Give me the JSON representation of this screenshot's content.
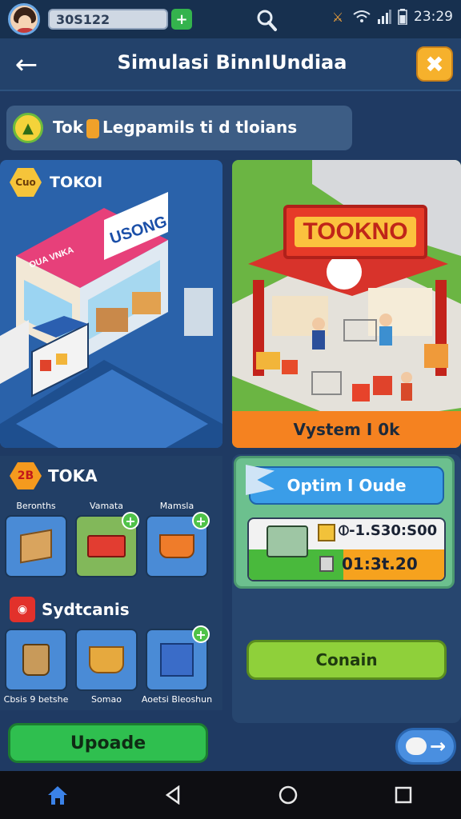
{
  "status_bar": {
    "coin_value": "30S122",
    "coin_plus": "+",
    "time": "23:29"
  },
  "header": {
    "title": "Simulasi BinnIUndiaa",
    "back": "←",
    "close": "✖"
  },
  "tip": {
    "prefix": "Tok",
    "text": "Legpamils ti d tloians"
  },
  "store_left": {
    "badge": "Cuo",
    "label": "TOKOI",
    "sign": "USONG",
    "sign_small": "OUA VNKA"
  },
  "store_right": {
    "sign": "TOOKNO",
    "footer": "Vystem I 0k"
  },
  "toka_panel": {
    "badge": "2B",
    "label": "TOKA",
    "tiles": [
      {
        "caption": "Beronths",
        "icon": "box-icon",
        "add": false
      },
      {
        "caption": "Vamata",
        "icon": "cart-icon",
        "add": true
      },
      {
        "caption": "Mamsla",
        "icon": "basket-icon",
        "add": true
      }
    ]
  },
  "systems_panel": {
    "label": "Sydtcanis",
    "tiles": [
      {
        "caption": "Cbsis 9 betshe",
        "icon": "bag-icon",
        "add": false
      },
      {
        "caption": "Somao",
        "icon": "coin-basket-icon",
        "add": false
      },
      {
        "caption": "Aoetsi Bleoshun",
        "icon": "shelf-icon",
        "add": true
      }
    ]
  },
  "optimum": {
    "button": "Optim I Oude",
    "stat_top": "⦶-1.S30:S00",
    "stat_bottom": "01:3t.20"
  },
  "buttons": {
    "confirm": "Conain",
    "update": "Upoade",
    "next_arrow": "→"
  },
  "colors": {
    "background": "#1f3a63",
    "accent_green": "#2fbf4f",
    "accent_orange": "#f58220",
    "accent_yellow": "#f6b12c",
    "accent_blue": "#3a9de8"
  }
}
